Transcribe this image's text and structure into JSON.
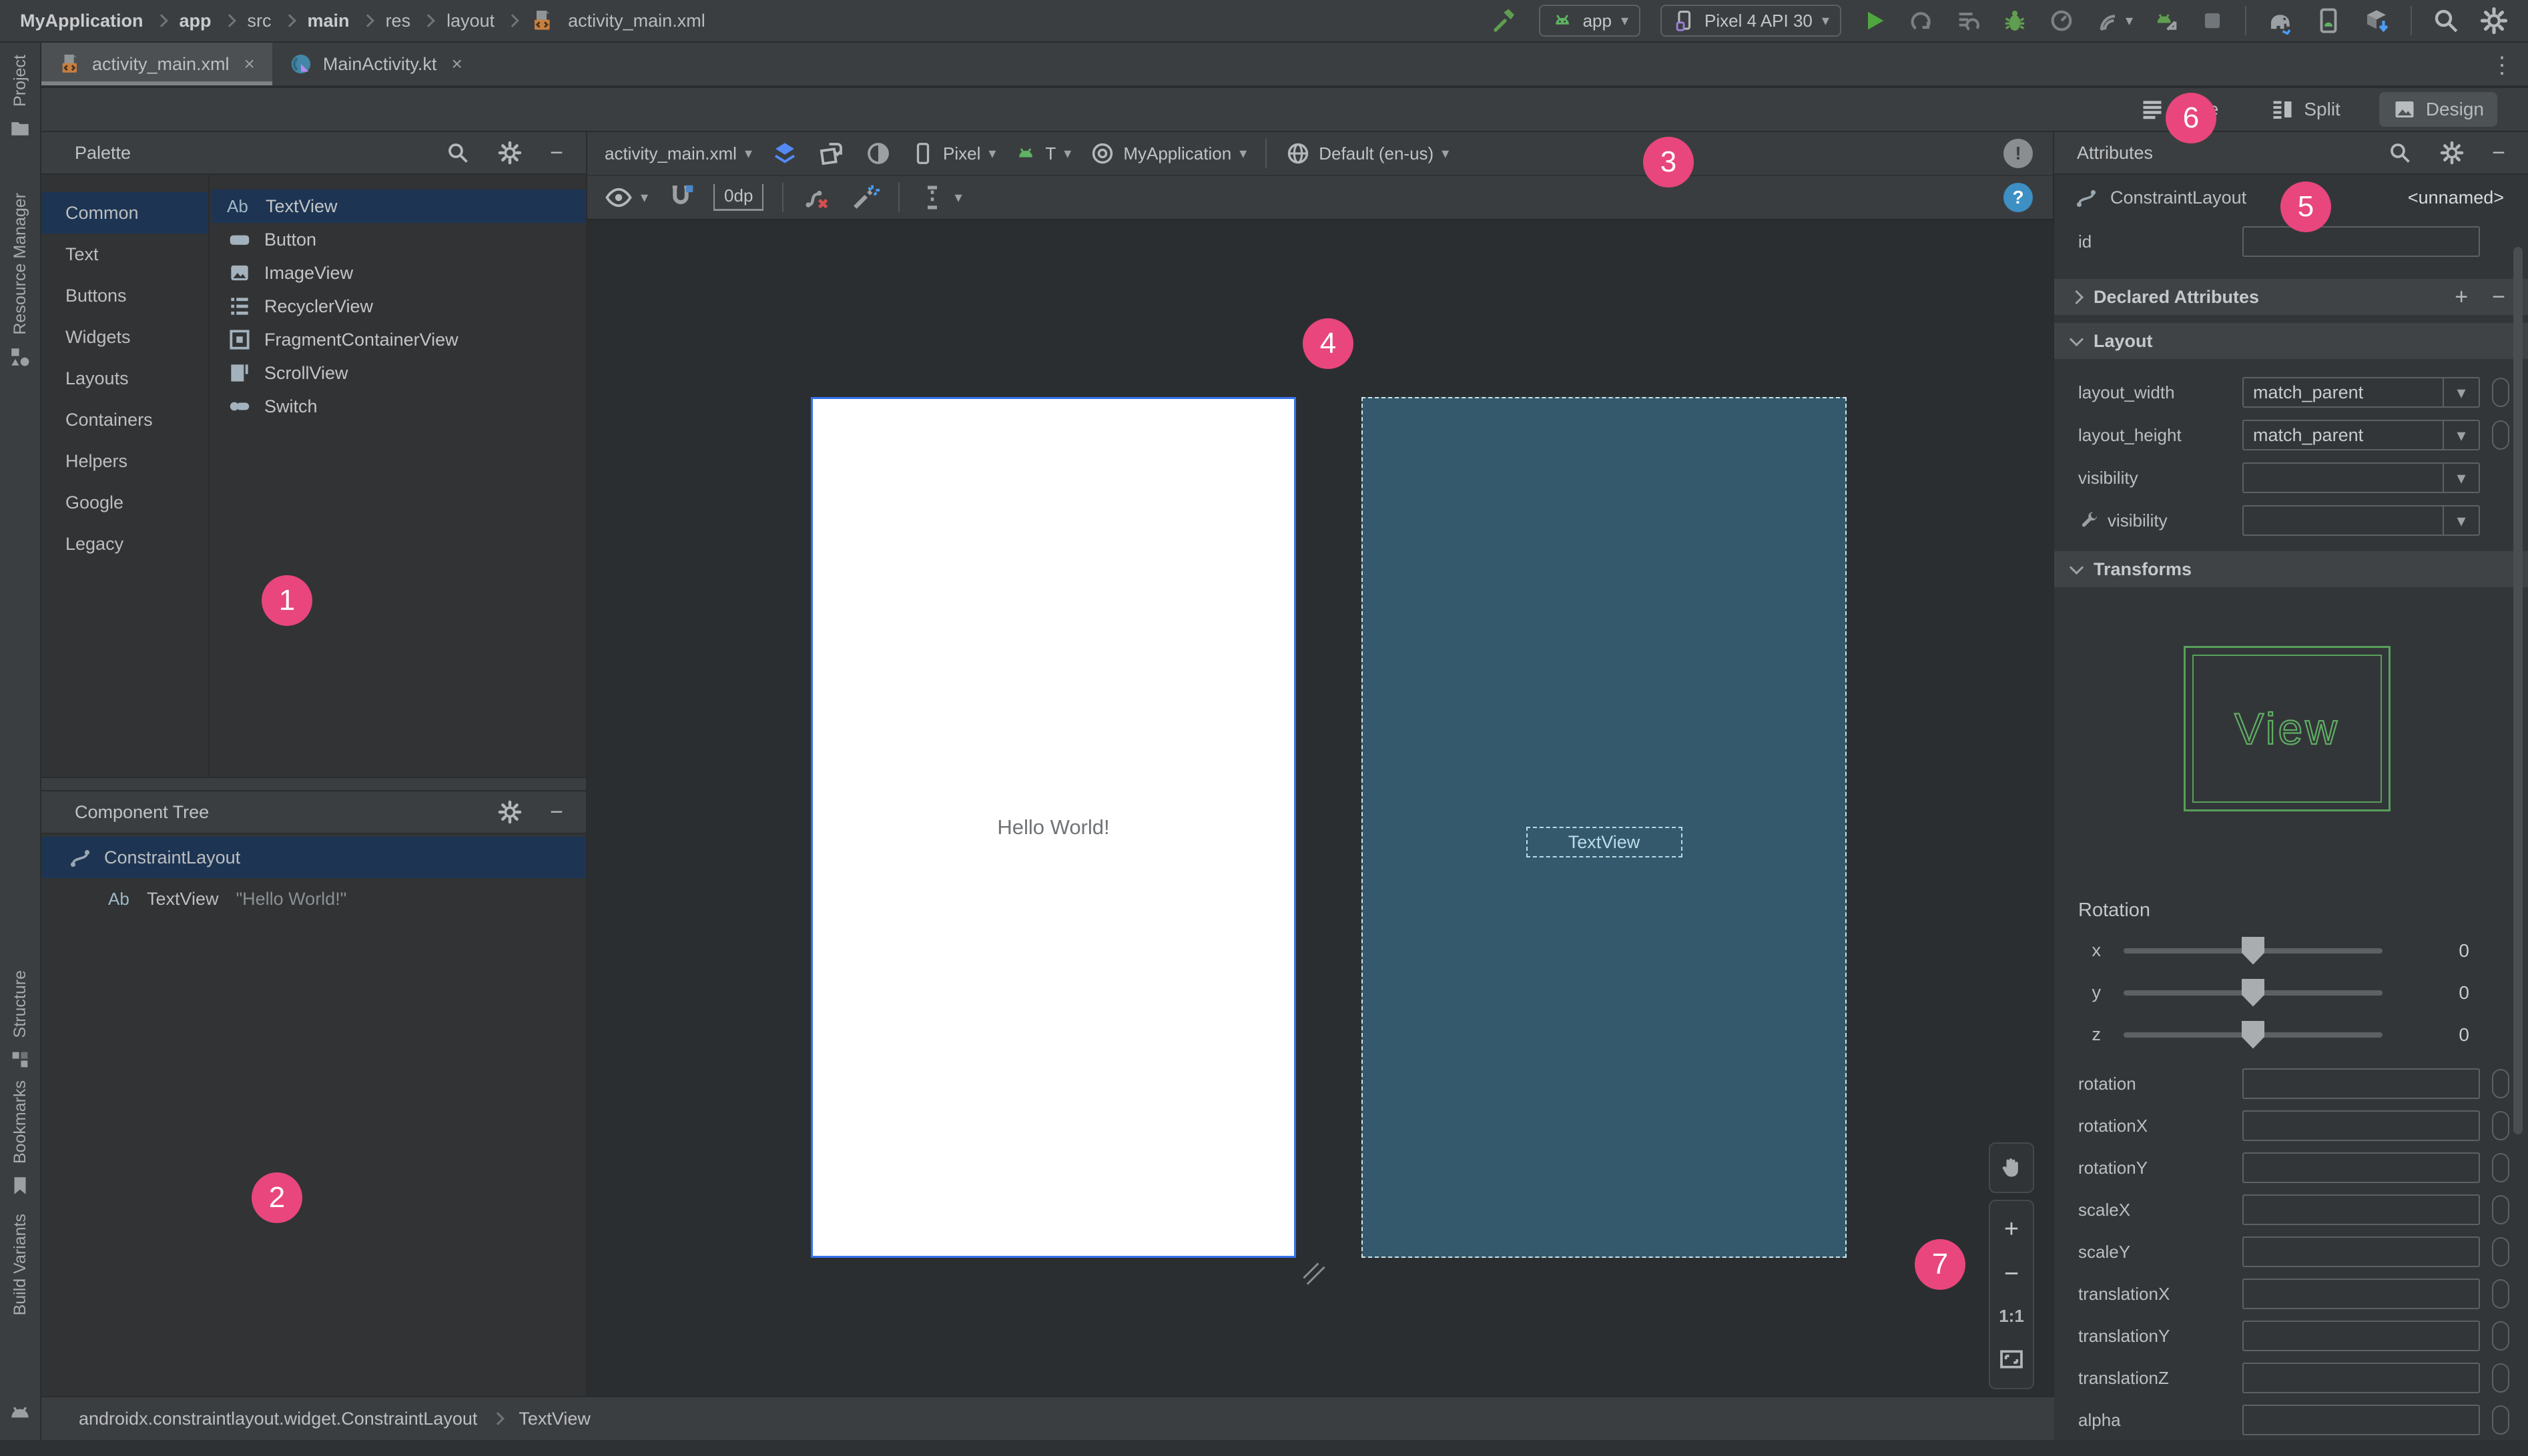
{
  "breadcrumbs": [
    "MyApplication",
    "app",
    "src",
    "main",
    "res",
    "layout",
    "activity_main.xml"
  ],
  "main_toolbar": {
    "run_config": "app",
    "device": "Pixel 4 API 30"
  },
  "tabs": [
    {
      "label": "activity_main.xml",
      "active": true
    },
    {
      "label": "MainActivity.kt",
      "active": false
    }
  ],
  "tool_windows": {
    "top": [
      "Project",
      "Resource Manager"
    ],
    "bottom": [
      "Structure",
      "Bookmarks",
      "Build Variants"
    ]
  },
  "editor_modes": {
    "code": "Code",
    "split": "Split",
    "design": "Design"
  },
  "palette": {
    "title": "Palette",
    "categories": [
      "Common",
      "Text",
      "Buttons",
      "Widgets",
      "Layouts",
      "Containers",
      "Helpers",
      "Google",
      "Legacy"
    ],
    "selected_category": "Common",
    "items": [
      "TextView",
      "Button",
      "ImageView",
      "RecyclerView",
      "FragmentContainerView",
      "ScrollView",
      "Switch"
    ],
    "selected_item": "TextView"
  },
  "component_tree": {
    "title": "Component Tree",
    "items": [
      {
        "label": "ConstraintLayout",
        "value": ""
      },
      {
        "label": "TextView",
        "value": "\"Hello World!\""
      }
    ]
  },
  "design_editor": {
    "file": "activity_main.xml",
    "device": "Pixel",
    "api_level": "T",
    "theme": "MyApplication",
    "locale": "Default (en-us)",
    "default_margin": "0dp",
    "design_preview_text": "Hello World!",
    "blueprint_component_label": "TextView"
  },
  "zoom_controls": {
    "ratio": "1:1"
  },
  "attributes_panel": {
    "title": "Attributes",
    "component_type": "ConstraintLayout",
    "component_id": "<unnamed>",
    "id_label": "id",
    "declared_section": "Declared Attributes",
    "layout_section": "Layout",
    "transforms_section": "Transforms",
    "layout_rows": [
      {
        "label": "layout_width",
        "value": "match_parent"
      },
      {
        "label": "layout_height",
        "value": "match_parent"
      },
      {
        "label": "visibility",
        "value": ""
      },
      {
        "label": "visibility",
        "value": ""
      }
    ],
    "view_preview_label": "View",
    "rotation_label": "Rotation",
    "sliders": [
      {
        "axis": "x",
        "value": "0"
      },
      {
        "axis": "y",
        "value": "0"
      },
      {
        "axis": "z",
        "value": "0"
      }
    ],
    "transform_rows": [
      "rotation",
      "rotationX",
      "rotationY",
      "scaleX",
      "scaleY",
      "translationX",
      "translationY",
      "translationZ",
      "alpha"
    ]
  },
  "status_bar": {
    "path": [
      "androidx.constraintlayout.widget.ConstraintLayout",
      "TextView"
    ]
  },
  "annotations": [
    "1",
    "2",
    "3",
    "4",
    "5",
    "6",
    "7"
  ],
  "icons": {
    "minus": "−",
    "plus": "+",
    "close": "×",
    "caret": "▾",
    "more_vertical": "⋮",
    "help": "?",
    "error": "!"
  },
  "colors": {
    "badge": "#e8467c",
    "selection": "#1d3553",
    "blueprint_bg": "#34596c",
    "phone_border": "#3573f0",
    "accent_green": "#57a64a",
    "accent_blue": "#548af7"
  }
}
